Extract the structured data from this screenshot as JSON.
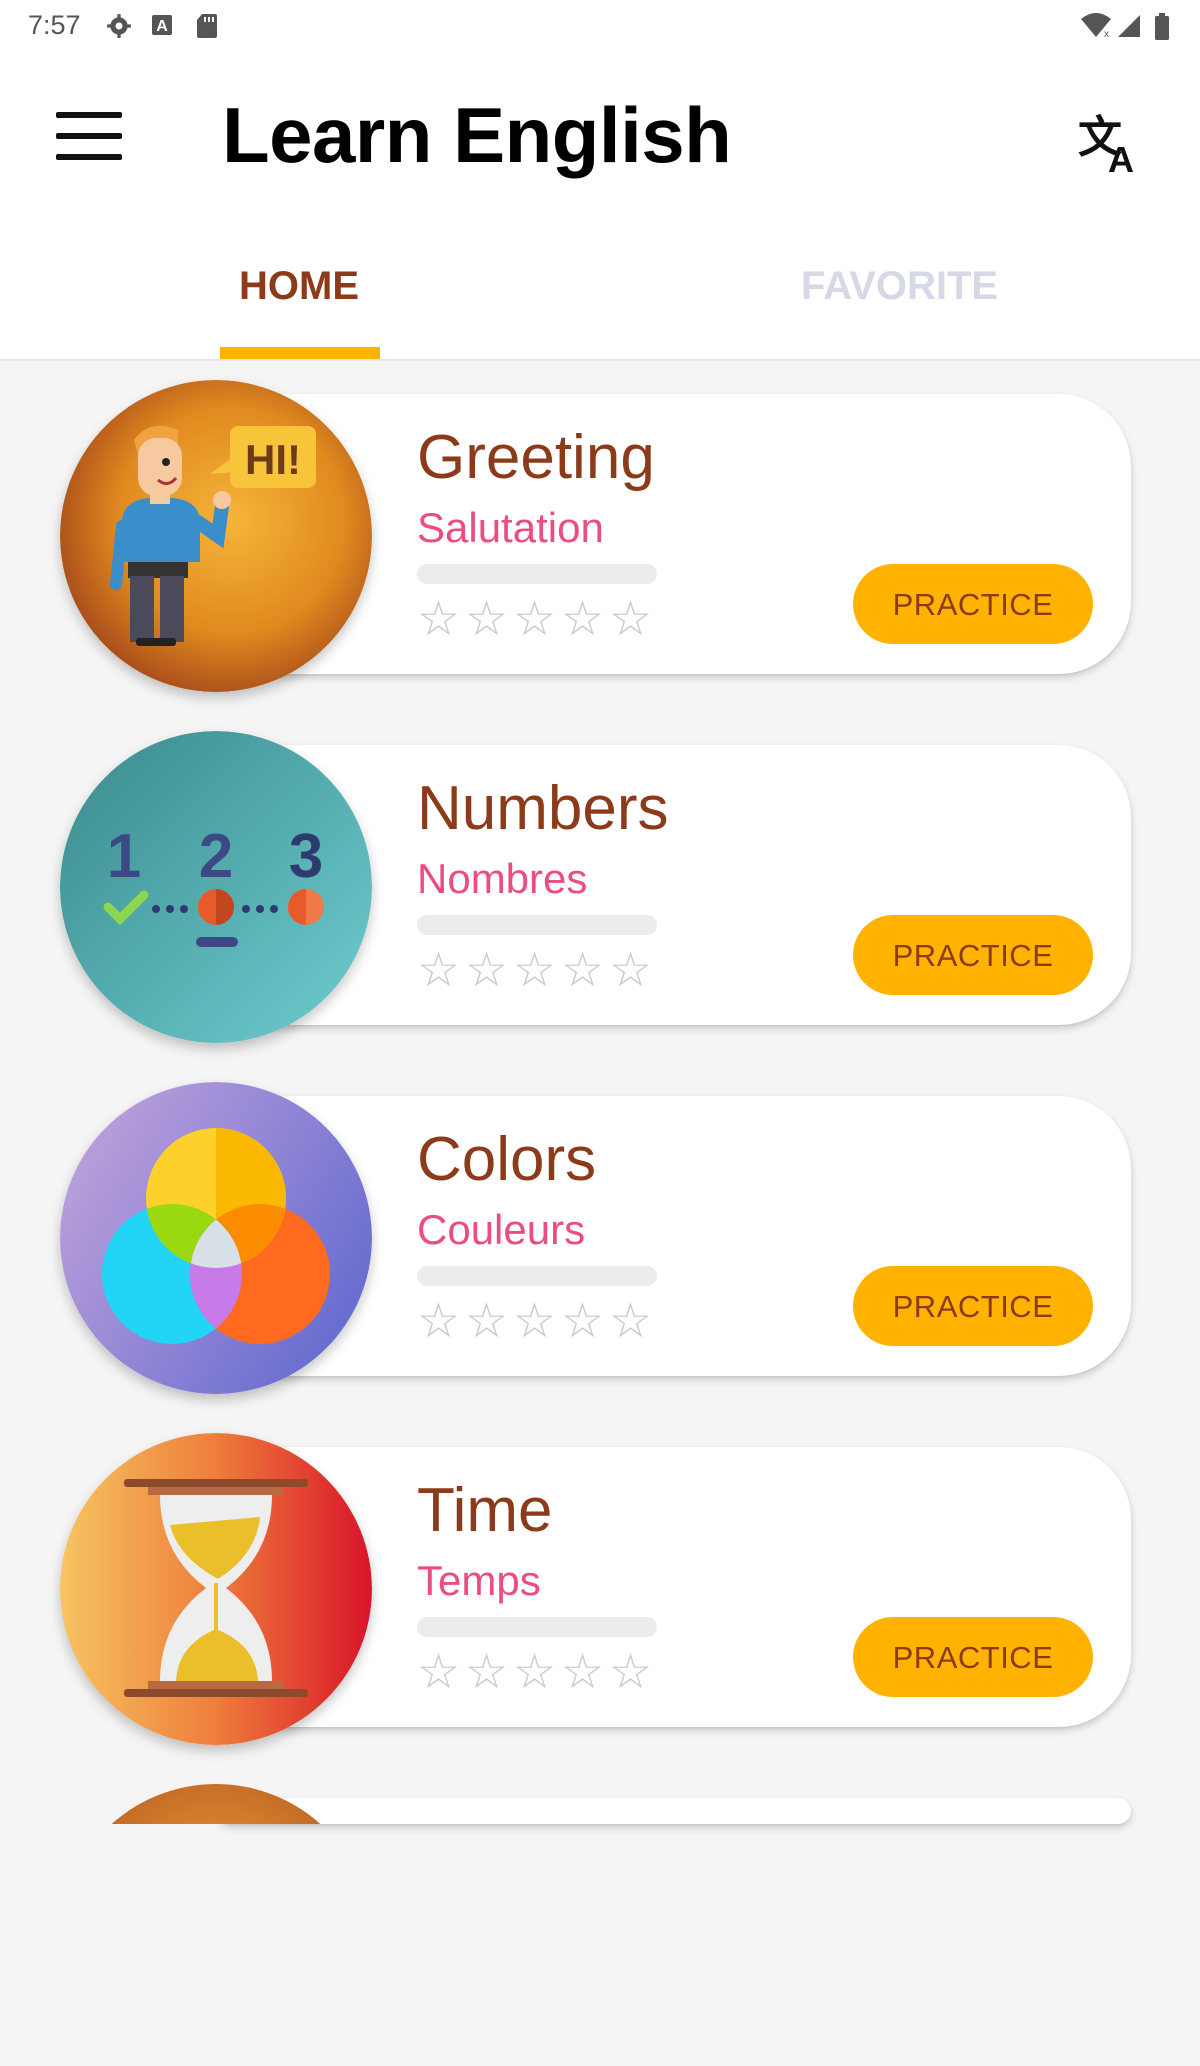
{
  "status_bar": {
    "time": "7:57",
    "icons": [
      "settings-icon",
      "a-icon",
      "sd-card-icon",
      "wifi-icon",
      "signal-icon",
      "battery-icon"
    ]
  },
  "app_bar": {
    "title": "Learn English",
    "menu_icon": "hamburger-menu-icon",
    "translate_icon": "translate-icon"
  },
  "tabs": [
    {
      "label": "HOME",
      "active": true
    },
    {
      "label": "FAVORITE",
      "active": false
    }
  ],
  "colors": {
    "accent": "#ffb300",
    "title": "#8b3a1a",
    "subtitle": "#ec4d80",
    "inactive_tab": "#d6d8e6"
  },
  "lessons": [
    {
      "title": "Greeting",
      "subtitle": "Salutation",
      "button": "PRACTICE",
      "stars": 0,
      "progress": 0,
      "image": "greeting-image"
    },
    {
      "title": "Numbers",
      "subtitle": "Nombres",
      "button": "PRACTICE",
      "stars": 0,
      "progress": 0,
      "image": "numbers-image"
    },
    {
      "title": "Colors",
      "subtitle": "Couleurs",
      "button": "PRACTICE",
      "stars": 0,
      "progress": 0,
      "image": "colors-image"
    },
    {
      "title": "Time",
      "subtitle": "Temps",
      "button": "PRACTICE",
      "stars": 0,
      "progress": 0,
      "image": "hourglass-image"
    }
  ],
  "star_glyph": "☆"
}
